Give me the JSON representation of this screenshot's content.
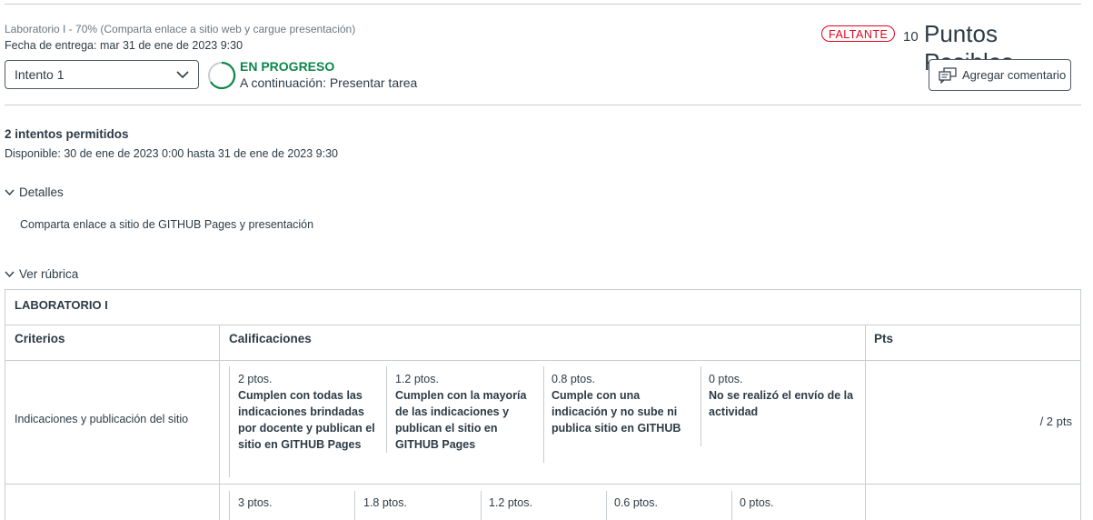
{
  "header": {
    "assignment_title": "Laboratorio I - 70% (Comparta enlace a sitio web y cargue presentación)",
    "due_label": "Fecha de entrega:",
    "due_value": "mar 31 de ene de 2023 9:30",
    "status_badge": "FALTANTE",
    "points_value": "10",
    "points_label": "Puntos Posibles"
  },
  "attempt": {
    "selected": "Intento 1",
    "status_title": "EN PROGRESO",
    "status_next": "A continuación: Presentar tarea"
  },
  "actions": {
    "add_comment": "Agregar comentario"
  },
  "info": {
    "attempts_allowed": "2 intentos permitidos",
    "available": "Disponible: 30 de ene de 2023 0:00 hasta 31 de ene de 2023 9:30"
  },
  "details": {
    "toggle_label": "Detalles",
    "text": "Comparta enlace a sitio de GITHUB Pages y presentación"
  },
  "rubric": {
    "toggle_label": "Ver rúbrica",
    "title": "LABORATORIO I",
    "headers": {
      "criteria": "Criterios",
      "ratings": "Calificaciones",
      "pts": "Pts"
    },
    "rows": [
      {
        "criterion": "Indicaciones y publicación del sitio",
        "ratings": [
          {
            "pts": "2 ptos.",
            "desc": "Cumplen con todas las indicaciones brindadas por docente y publican el sitio en GITHUB Pages"
          },
          {
            "pts": "1.2 ptos.",
            "desc": "Cumplen con la mayoría de las indicaciones y publican el sitio en GITHUB Pages"
          },
          {
            "pts": "0.8 ptos.",
            "desc": "Cumple con una indicación y no sube ni publica sitio en GITHUB"
          },
          {
            "pts": "0 ptos.",
            "desc": "No se realizó el envío de la actividad"
          }
        ],
        "score": "/ 2 pts"
      },
      {
        "criterion": "",
        "ratings": [
          {
            "pts": "3 ptos."
          },
          {
            "pts": "1.8 ptos."
          },
          {
            "pts": "1.2 ptos."
          },
          {
            "pts": "0.6 ptos."
          },
          {
            "pts": "0 ptos."
          }
        ],
        "score": ""
      }
    ]
  }
}
